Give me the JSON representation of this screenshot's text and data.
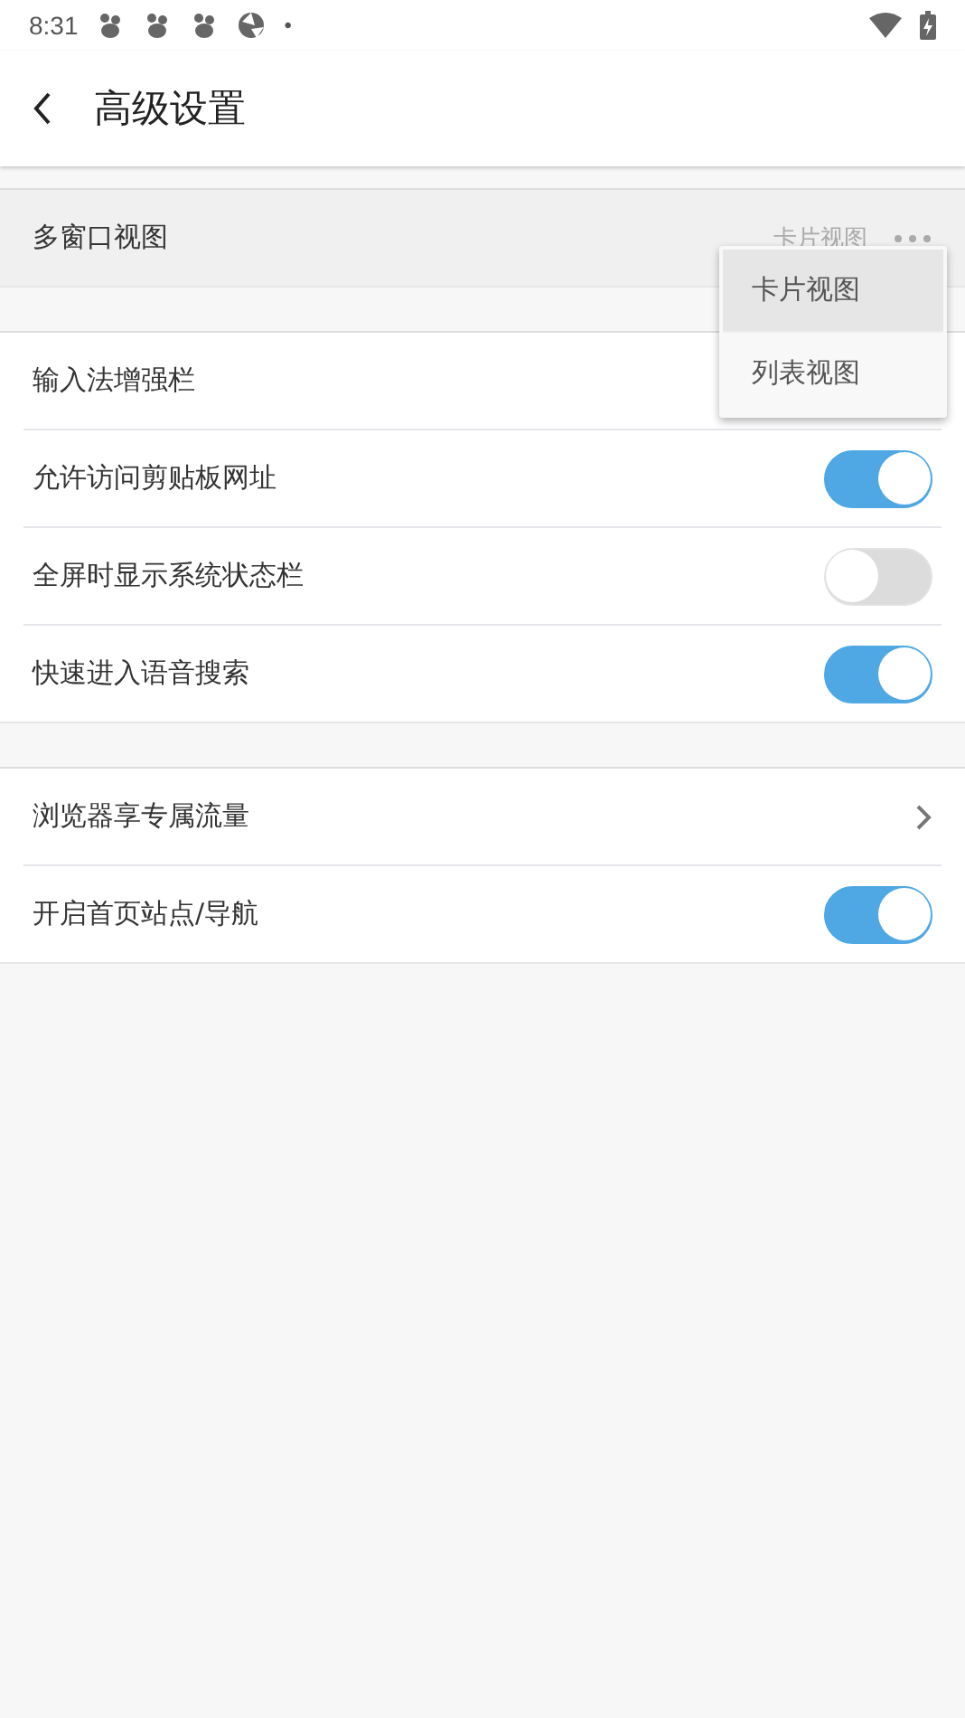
{
  "status_bar": {
    "time": "8:31",
    "dot": "•"
  },
  "header": {
    "title": "高级设置"
  },
  "sections": [
    {
      "rows": [
        {
          "label": "多窗口视图",
          "kind": "value",
          "value": "卡片视图",
          "pressed": true
        }
      ]
    },
    {
      "rows": [
        {
          "label": "输入法增强栏",
          "kind": "plain",
          "pressed": false
        },
        {
          "label": "允许访问剪贴板网址",
          "kind": "toggle",
          "on": true,
          "pressed": false
        },
        {
          "label": "全屏时显示系统状态栏",
          "kind": "toggle",
          "on": false,
          "pressed": false
        },
        {
          "label": "快速进入语音搜索",
          "kind": "toggle",
          "on": true,
          "pressed": false
        }
      ]
    },
    {
      "rows": [
        {
          "label": "浏览器享专属流量",
          "kind": "link",
          "pressed": false
        },
        {
          "label": "开启首页站点/导航",
          "kind": "toggle",
          "on": true,
          "pressed": false
        }
      ]
    }
  ],
  "menu": {
    "items": [
      {
        "label": "卡片视图",
        "selected": true
      },
      {
        "label": "列表视图",
        "selected": false
      }
    ]
  }
}
